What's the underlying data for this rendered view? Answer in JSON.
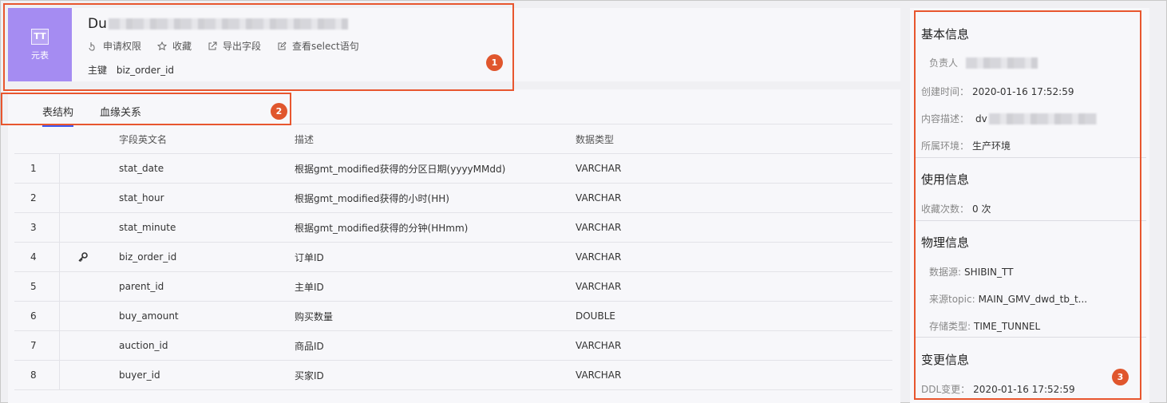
{
  "header": {
    "avatar_badge": "TT",
    "avatar_label": "元表",
    "title_prefix": "Du",
    "actions": [
      {
        "label": "申请权限",
        "icon": "hand-pointer-icon"
      },
      {
        "label": "收藏",
        "icon": "star-icon"
      },
      {
        "label": "导出字段",
        "icon": "export-icon"
      },
      {
        "label": "查看select语句",
        "icon": "edit-icon"
      }
    ],
    "pk_label": "主键",
    "pk_value": "biz_order_id"
  },
  "tabs": [
    {
      "label": "表结构",
      "active": true
    },
    {
      "label": "血缘关系",
      "active": false
    }
  ],
  "table": {
    "columns": [
      "字段英文名",
      "描述",
      "数据类型"
    ],
    "rows": [
      {
        "idx": "1",
        "key": false,
        "name": "stat_date",
        "desc": "根据gmt_modified获得的分区日期(yyyyMMdd)",
        "type": "VARCHAR"
      },
      {
        "idx": "2",
        "key": false,
        "name": "stat_hour",
        "desc": "根据gmt_modified获得的小时(HH)",
        "type": "VARCHAR"
      },
      {
        "idx": "3",
        "key": false,
        "name": "stat_minute",
        "desc": "根据gmt_modified获得的分钟(HHmm)",
        "type": "VARCHAR"
      },
      {
        "idx": "4",
        "key": true,
        "name": "biz_order_id",
        "desc": "订单ID",
        "type": "VARCHAR"
      },
      {
        "idx": "5",
        "key": false,
        "name": "parent_id",
        "desc": "主单ID",
        "type": "VARCHAR"
      },
      {
        "idx": "6",
        "key": false,
        "name": "buy_amount",
        "desc": "购买数量",
        "type": "DOUBLE"
      },
      {
        "idx": "7",
        "key": false,
        "name": "auction_id",
        "desc": "商品ID",
        "type": "VARCHAR"
      },
      {
        "idx": "8",
        "key": false,
        "name": "buyer_id",
        "desc": "买家ID",
        "type": "VARCHAR"
      }
    ]
  },
  "side": {
    "basic_title": "基本信息",
    "owner_label": "负责人",
    "created_label": "创建时间：",
    "created_value": "2020-01-16 17:52:59",
    "desc_label": "内容描述：",
    "desc_value": "dv",
    "env_label": "所属环境：",
    "env_value": "生产环境",
    "usage_title": "使用信息",
    "fav_label": "收藏次数：",
    "fav_value": "0 次",
    "physical_title": "物理信息",
    "ds_label": "数据源:",
    "ds_value": "SHIBIN_TT",
    "topic_label": "来源topic:",
    "topic_value": "MAIN_GMV_dwd_tb_t...",
    "storage_label": "存储类型:",
    "storage_value": "TIME_TUNNEL",
    "change_title": "变更信息",
    "ddl_label": "DDL变更：",
    "ddl_value": "2020-01-16 17:52:59"
  },
  "callouts": [
    "1",
    "2",
    "3"
  ],
  "colors": {
    "accent": "#3d5af1",
    "avatar": "#a58cf2",
    "callout": "#e8562e"
  }
}
